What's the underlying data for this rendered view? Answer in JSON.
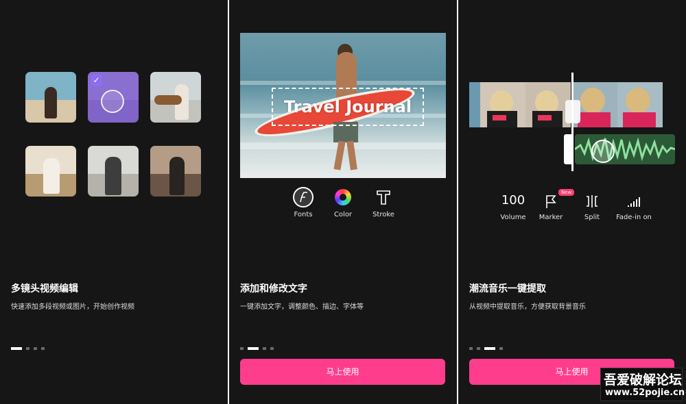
{
  "screens": [
    {
      "title": "多镜头视频编辑",
      "subtitle": "快速添加多段视频或图片，开始创作视频",
      "page_indicator": {
        "total": 4,
        "active": 1
      },
      "thumbnails": [
        {
          "subject": "woman-at-beach",
          "selected": false
        },
        {
          "subject": "person-in-field",
          "selected": true
        },
        {
          "subject": "person-with-guitar",
          "selected": false
        },
        {
          "subject": "woman-in-dress-field",
          "selected": false
        },
        {
          "subject": "man-with-backpack",
          "selected": false
        },
        {
          "subject": "woman-in-sunset",
          "selected": false
        }
      ]
    },
    {
      "title": "添加和修改文字",
      "subtitle": "一键添加文字，调整颜色、描边、字体等",
      "overlay_text": "Travel Journal",
      "tools": [
        {
          "label": "Fonts",
          "icon": "font-icon"
        },
        {
          "label": "Color",
          "icon": "color-wheel-icon"
        },
        {
          "label": "Stroke",
          "icon": "stroke-icon"
        }
      ],
      "page_indicator": {
        "total": 4,
        "active": 2
      },
      "cta": "马上使用"
    },
    {
      "title": "潮流音乐一键提取",
      "subtitle": "从视频中提取音乐，方便获取背景音乐",
      "controls": [
        {
          "value": "100",
          "label": "Volume"
        },
        {
          "label": "Marker",
          "icon": "flag-icon",
          "badge": "New"
        },
        {
          "label": "Split",
          "icon": "split-icon"
        },
        {
          "label": "Fade-in on",
          "icon": "fade-in-icon"
        }
      ],
      "page_indicator": {
        "total": 4,
        "active": 3
      },
      "cta": "马上使用"
    }
  ],
  "watermark": {
    "line1": "吾爱破解论坛",
    "line2": "www.52pojie.cn"
  },
  "colors": {
    "accent": "#ff3d8d",
    "background": "#161616",
    "selection": "#8d6df0"
  }
}
